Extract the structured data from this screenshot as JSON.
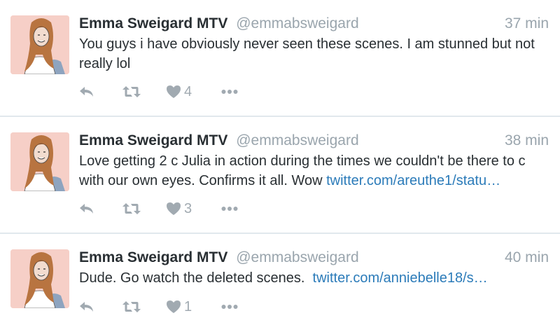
{
  "tweets": [
    {
      "name": "Emma Sweigard MTV",
      "handle": "@emmabsweigard",
      "time": "37 min",
      "text": "You guys i have obviously never seen these scenes. I am stunned but not really lol",
      "link": "",
      "likes": "4"
    },
    {
      "name": "Emma Sweigard MTV",
      "handle": "@emmabsweigard",
      "time": "38 min",
      "text": "Love getting 2 c Julia in action during the times we couldn't be there to c with our own eyes. Confirms it all. Wow ",
      "link": "twitter.com/areuthe1/statu…",
      "likes": "3"
    },
    {
      "name": "Emma Sweigard MTV",
      "handle": "@emmabsweigard",
      "time": "40 min",
      "text": "Dude. Go watch the deleted scenes.  ",
      "link": "twitter.com/anniebelle18/s…",
      "likes": "1"
    }
  ],
  "icons": {
    "reply": "reply-icon",
    "retweet": "retweet-icon",
    "like": "heart-icon",
    "more": "more-dots-icon"
  },
  "colors": {
    "text": "#292f33",
    "muted": "#9aa5ad",
    "link": "#2b7bb9",
    "action": "#a1aab1",
    "divider": "#e1e8ed",
    "avatar_bg": "#f6cfc7"
  }
}
